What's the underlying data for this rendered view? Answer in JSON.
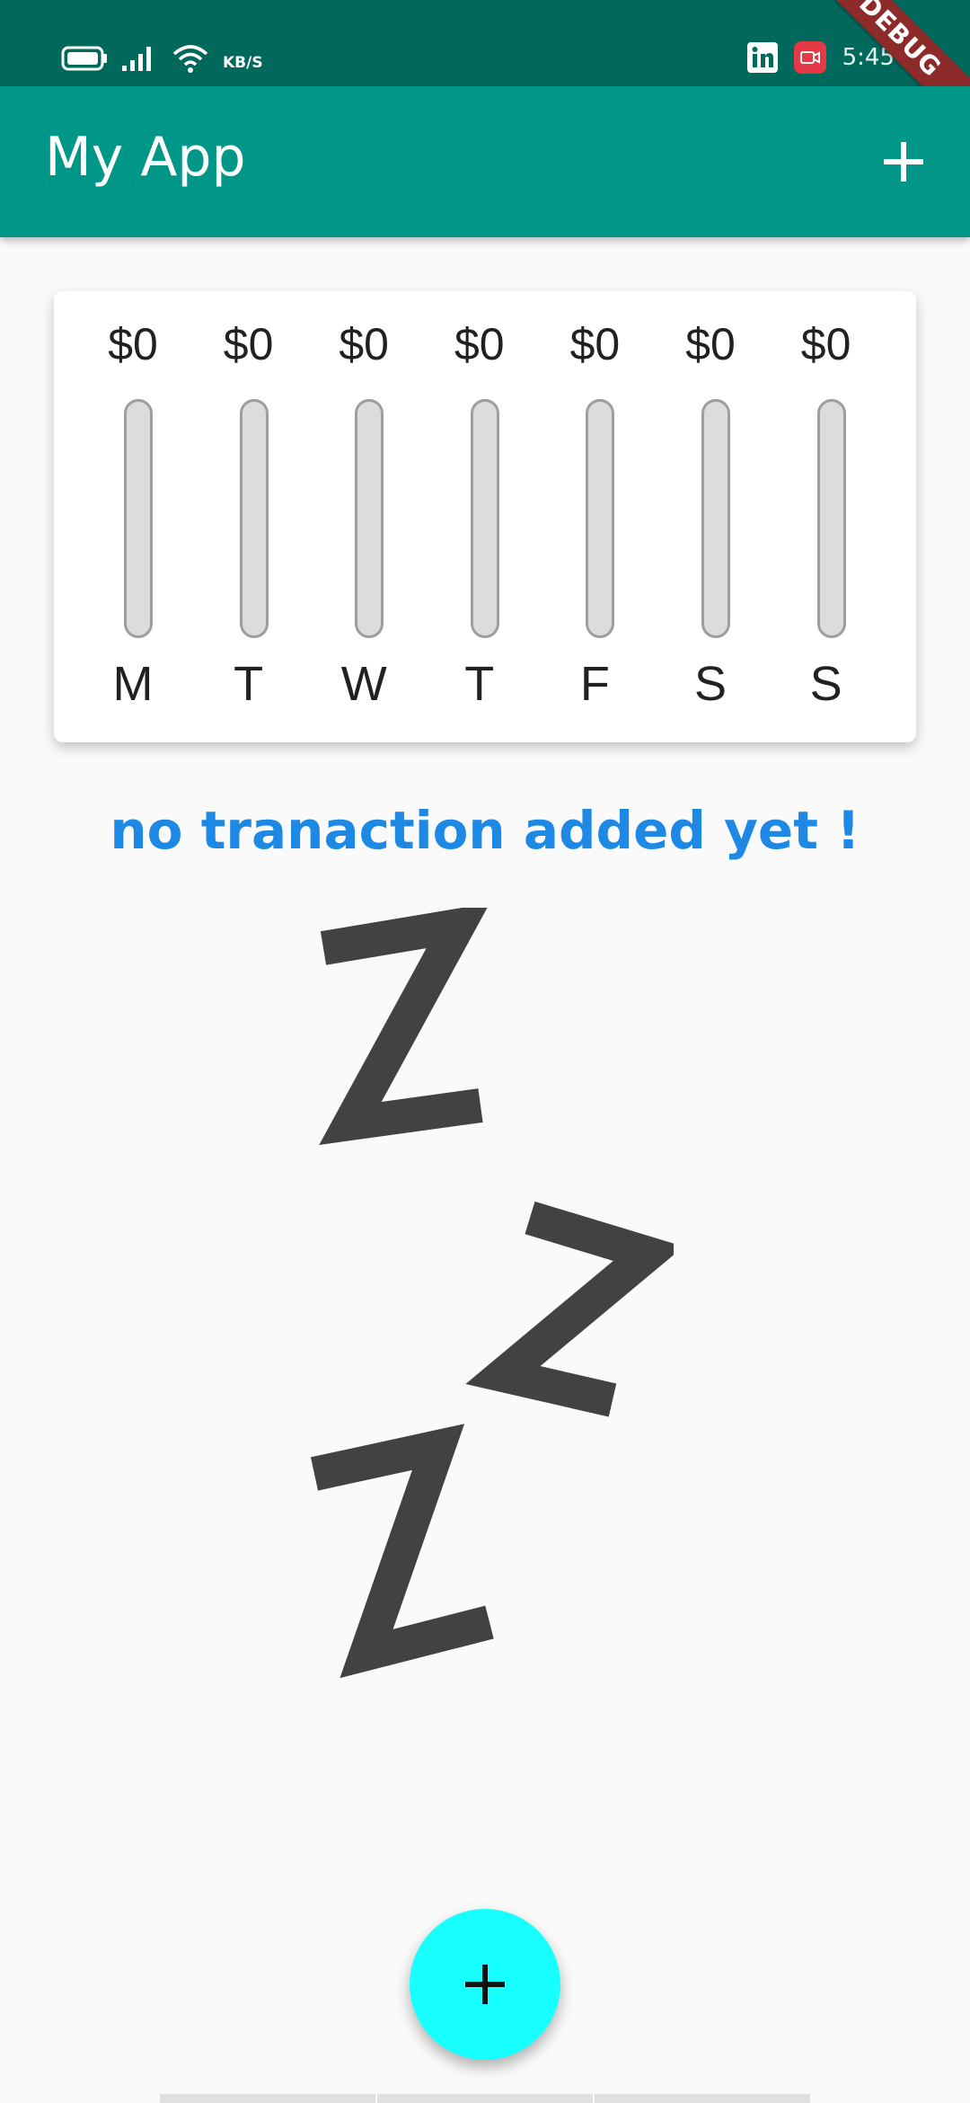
{
  "status_bar": {
    "network_speed": "KB/S",
    "time": "5:45",
    "debug_label": "DEBUG",
    "icons": [
      "battery-icon",
      "signal-icon",
      "wifi-icon",
      "linkedin-icon",
      "screen-recorder-icon"
    ]
  },
  "app_bar": {
    "title": "My App",
    "action_icon": "add-icon"
  },
  "chart_data": {
    "type": "bar",
    "categories": [
      "M",
      "T",
      "W",
      "T",
      "F",
      "S",
      "S"
    ],
    "values": [
      0,
      0,
      0,
      0,
      0,
      0,
      0
    ],
    "value_labels": [
      "$0",
      "$0",
      "$0",
      "$0",
      "$0",
      "$0",
      "$0"
    ],
    "fill_fractions": [
      0,
      0,
      0,
      0,
      0,
      0,
      0
    ]
  },
  "empty_state": {
    "message": "no tranaction added yet !",
    "illustration_icon": "sleeping-zzz-icon"
  },
  "fab": {
    "icon": "add-icon"
  },
  "colors": {
    "status_bar": "#00695c",
    "app_bar": "#009688",
    "message": "#1e88e5",
    "fab": "#18ffff",
    "bar_track": "#dcdcdc"
  }
}
